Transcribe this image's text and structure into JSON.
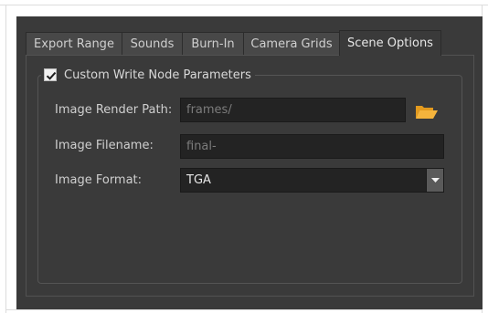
{
  "tabs": [
    {
      "label": "Export Range",
      "active": false
    },
    {
      "label": "Sounds",
      "active": false
    },
    {
      "label": "Burn-In",
      "active": false
    },
    {
      "label": "Camera Grids",
      "active": false
    },
    {
      "label": "Scene Options",
      "active": true
    }
  ],
  "group": {
    "label": "Custom Write Node Parameters",
    "checked": true
  },
  "fields": {
    "render_path": {
      "label": "Image Render Path:",
      "value": "frames/"
    },
    "filename": {
      "label": "Image Filename:",
      "value": "final-"
    },
    "format": {
      "label": "Image Format:",
      "value": "TGA"
    }
  },
  "icons": {
    "browse": "folder-icon",
    "dropdown": "chevron-down-icon",
    "check": "checkmark-icon"
  },
  "colors": {
    "dialog_bg": "#3a3a3a",
    "field_bg": "#232323",
    "folder": "#f0a830"
  }
}
